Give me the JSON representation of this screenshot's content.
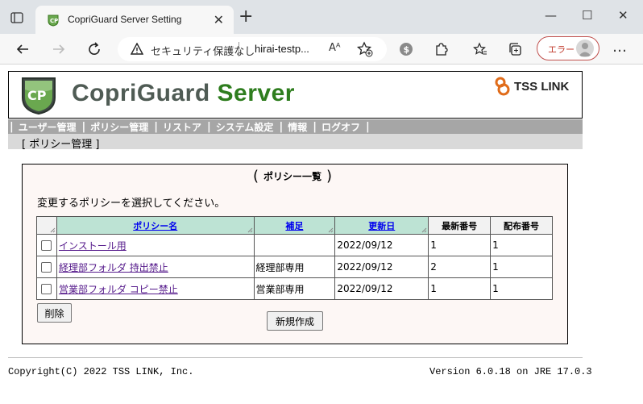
{
  "browser": {
    "tab_title": "CopriGuard Server Setting",
    "security_text": "セキュリティ保護なし",
    "url": "hirai-testp...",
    "read_aloud": "Aᴬ",
    "error_label": "エラー",
    "more": "…"
  },
  "header": {
    "brand_part1": "CopriGuard",
    "brand_part2": "Server",
    "partner_logo": "TSS LINK"
  },
  "menu": {
    "items": [
      "ユーザー管理",
      "ポリシー管理",
      "リストア",
      "システム設定",
      "情報",
      "ログオフ"
    ]
  },
  "breadcrumb": "[ ポリシー管理 ]",
  "panel": {
    "title": "ポリシー一覧",
    "instruction": "変更するポリシーを選択してください。",
    "columns": [
      "ポリシー名",
      "補足",
      "更新日",
      "最新番号",
      "配布番号"
    ],
    "rows": [
      {
        "name": "インストール用",
        "note": "",
        "updated": "2022/09/12",
        "latest": "1",
        "distributed": "1"
      },
      {
        "name": "経理部フォルダ 持出禁止",
        "note": "経理部専用",
        "updated": "2022/09/12",
        "latest": "2",
        "distributed": "1"
      },
      {
        "name": "営業部フォルダ コピー禁止",
        "note": "営業部専用",
        "updated": "2022/09/12",
        "latest": "1",
        "distributed": "1"
      }
    ],
    "delete_label": "削除",
    "create_label": "新規作成"
  },
  "footer": {
    "copyright": "Copyright(C) 2022 TSS LINK, Inc.",
    "version": "Version 6.0.18 on JRE 17.0.3"
  },
  "colors": {
    "brand_gray": "#4f5b54",
    "brand_green": "#2e7d1e",
    "menubar": "#a6a6a6",
    "header_cell": "#bde3d4",
    "panel_bg": "#fdf7f5",
    "error_red": "#c0392b"
  }
}
